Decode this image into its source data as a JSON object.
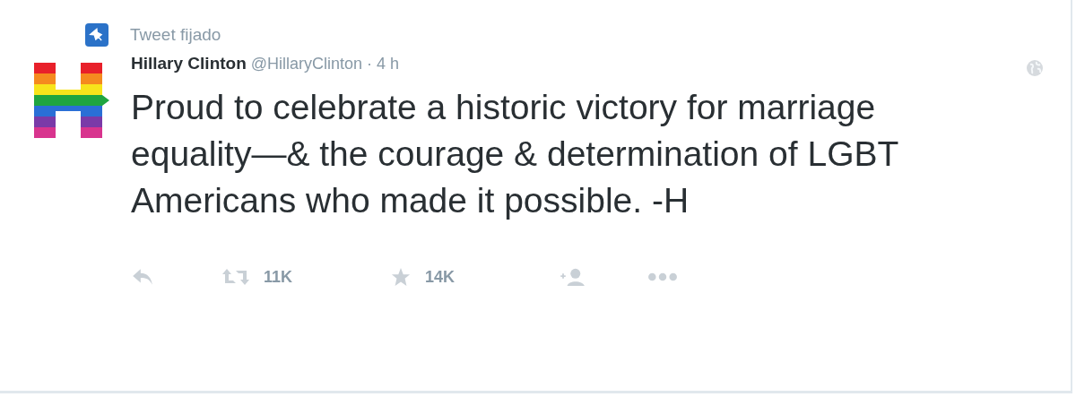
{
  "pinned_label": "Tweet fijado",
  "tweet": {
    "name": "Hillary Clinton",
    "handle": "@HillaryClinton",
    "separator": "·",
    "time": "4 h",
    "text": "Proud to celebrate a historic victory for marriage equality—& the courage & determination of LGBT Americans who made it possible. -H"
  },
  "actions": [
    {
      "kind": "reply"
    },
    {
      "kind": "retweet",
      "count": "11K"
    },
    {
      "kind": "favorite",
      "count": "14K"
    },
    {
      "kind": "follow"
    },
    {
      "kind": "more"
    }
  ]
}
